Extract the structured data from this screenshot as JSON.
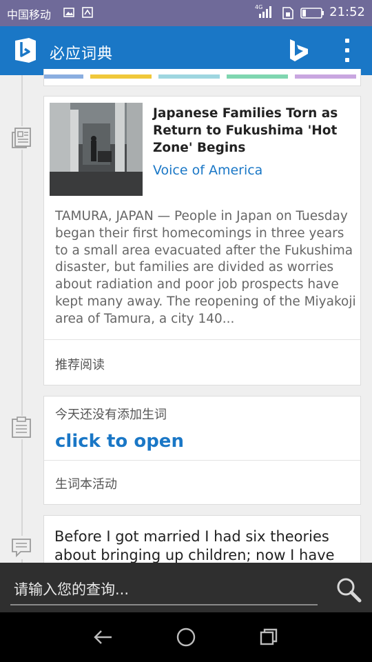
{
  "status_bar": {
    "carrier": "中国移动",
    "network": "4G",
    "time": "21:52"
  },
  "app_bar": {
    "title": "必应词典",
    "icons": [
      "app-logo-icon",
      "bing-logo-icon",
      "overflow-menu-icon"
    ]
  },
  "colors": {
    "primary": "#1a77c6",
    "status_bar": "#6f6a99",
    "tab_colors": [
      "#8aaee0",
      "#f0c83a",
      "#9ed6e0",
      "#7fd6b0",
      "#c9a6e0"
    ]
  },
  "news_card": {
    "title": "Japanese Families Torn as Return to Fukushima 'Hot Zone' Begins",
    "source": "Voice of America",
    "body": "TAMURA, JAPAN — People in Japan on Tuesday began their first homecomings in three years to a small area evacuated after the Fukushima disaster, but families are divided as worries about radiation and poor job prospects have kept many away. The reopening of the Miyakoji area of Tamura, a city 140...",
    "footer": "推荐阅读"
  },
  "words_card": {
    "empty_text": "今天还没有添加生词",
    "link": "click to open",
    "footer": "生词本活动"
  },
  "quote_card": {
    "text": "Before I got married I had six theories about bringing up children; now I have"
  },
  "search": {
    "placeholder": "请输入您的查询..."
  }
}
